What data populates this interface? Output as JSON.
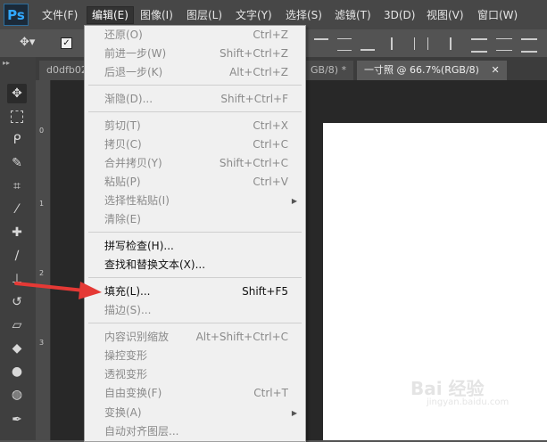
{
  "app": {
    "logo": "Ps"
  },
  "menubar": {
    "items": [
      {
        "label": "文件(F)",
        "active": false
      },
      {
        "label": "编辑(E)",
        "active": true
      },
      {
        "label": "图像(I)",
        "active": false
      },
      {
        "label": "图层(L)",
        "active": false
      },
      {
        "label": "文字(Y)",
        "active": false
      },
      {
        "label": "选择(S)",
        "active": false
      },
      {
        "label": "滤镜(T)",
        "active": false
      },
      {
        "label": "3D(D)",
        "active": false
      },
      {
        "label": "视图(V)",
        "active": false
      },
      {
        "label": "窗口(W)",
        "active": false
      }
    ]
  },
  "tabs": [
    {
      "label": "d0dfb02"
    },
    {
      "label": "GB/8) *"
    },
    {
      "label": "一寸照 @ 66.7%(RGB/8)"
    }
  ],
  "ruler": {
    "marks": [
      "0",
      "1",
      "2",
      "3"
    ]
  },
  "edit_menu": {
    "items": [
      {
        "label": "还原(O)",
        "shortcut": "Ctrl+Z",
        "disabled": true
      },
      {
        "label": "前进一步(W)",
        "shortcut": "Shift+Ctrl+Z",
        "disabled": true
      },
      {
        "label": "后退一步(K)",
        "shortcut": "Alt+Ctrl+Z",
        "disabled": true
      },
      {
        "sep": true
      },
      {
        "label": "渐隐(D)...",
        "shortcut": "Shift+Ctrl+F",
        "disabled": true
      },
      {
        "sep": true
      },
      {
        "label": "剪切(T)",
        "shortcut": "Ctrl+X",
        "disabled": true
      },
      {
        "label": "拷贝(C)",
        "shortcut": "Ctrl+C",
        "disabled": true
      },
      {
        "label": "合并拷贝(Y)",
        "shortcut": "Shift+Ctrl+C",
        "disabled": true
      },
      {
        "label": "粘贴(P)",
        "shortcut": "Ctrl+V",
        "disabled": true
      },
      {
        "label": "选择性粘贴(I)",
        "shortcut": "",
        "disabled": true,
        "submenu": true
      },
      {
        "label": "清除(E)",
        "shortcut": "",
        "disabled": true
      },
      {
        "sep": true
      },
      {
        "label": "拼写检查(H)...",
        "shortcut": "",
        "disabled": false
      },
      {
        "label": "查找和替换文本(X)...",
        "shortcut": "",
        "disabled": false
      },
      {
        "sep": true
      },
      {
        "label": "填充(L)...",
        "shortcut": "Shift+F5",
        "disabled": false
      },
      {
        "label": "描边(S)...",
        "shortcut": "",
        "disabled": true
      },
      {
        "sep": true
      },
      {
        "label": "内容识别缩放",
        "shortcut": "Alt+Shift+Ctrl+C",
        "disabled": true
      },
      {
        "label": "操控变形",
        "shortcut": "",
        "disabled": true
      },
      {
        "label": "透视变形",
        "shortcut": "",
        "disabled": true
      },
      {
        "label": "自由变换(F)",
        "shortcut": "Ctrl+T",
        "disabled": true
      },
      {
        "label": "变换(A)",
        "shortcut": "",
        "disabled": true,
        "submenu": true
      },
      {
        "label": "自动对齐图层...",
        "shortcut": "",
        "disabled": true
      }
    ]
  },
  "watermark": {
    "text": "Bai 经验",
    "sub": "jingyan.baidu.com"
  },
  "colors": {
    "accent": "#31a8ff",
    "arrow": "#e53935",
    "menu_bg": "#f0f0f0"
  }
}
